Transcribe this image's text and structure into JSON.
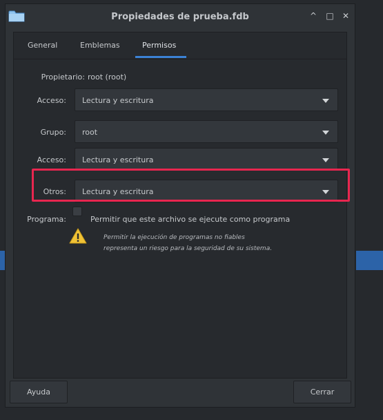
{
  "window": {
    "title": "Propiedades de prueba.fdb"
  },
  "wm": {
    "minimize": "^",
    "maximize": "□",
    "close": "✕"
  },
  "tabs": [
    {
      "label": "General"
    },
    {
      "label": "Emblemas"
    },
    {
      "label": "Permisos",
      "active": true
    }
  ],
  "permissions": {
    "owner_label": "Propietario:",
    "owner_value": "root (root)",
    "owner_access_label": "Acceso:",
    "owner_access_value": "Lectura y escritura",
    "group_label": "Grupo:",
    "group_value": "root",
    "group_access_label": "Acceso:",
    "group_access_value": "Lectura y escritura",
    "others_label": "Otros:",
    "others_value": "Lectura y escritura",
    "program_label": "Programa:",
    "program_checkbox_label": "Permitir que este archivo se ejecute como programa",
    "program_checked": false,
    "warning_line1": "Permitir la ejecución de programas no fiables",
    "warning_line2": "representa un riesgo para la seguridad de su sistema."
  },
  "buttons": {
    "help": "Ayuda",
    "close": "Cerrar"
  },
  "colors": {
    "highlight": "#e8264f",
    "tab_active_underline": "#3b82d6",
    "warning": "#f0c236",
    "background_strip": "#2c63a8"
  },
  "icons": {
    "folder": "folder-icon",
    "warning": "warning-icon",
    "dropdown": "chevron-down-icon"
  }
}
